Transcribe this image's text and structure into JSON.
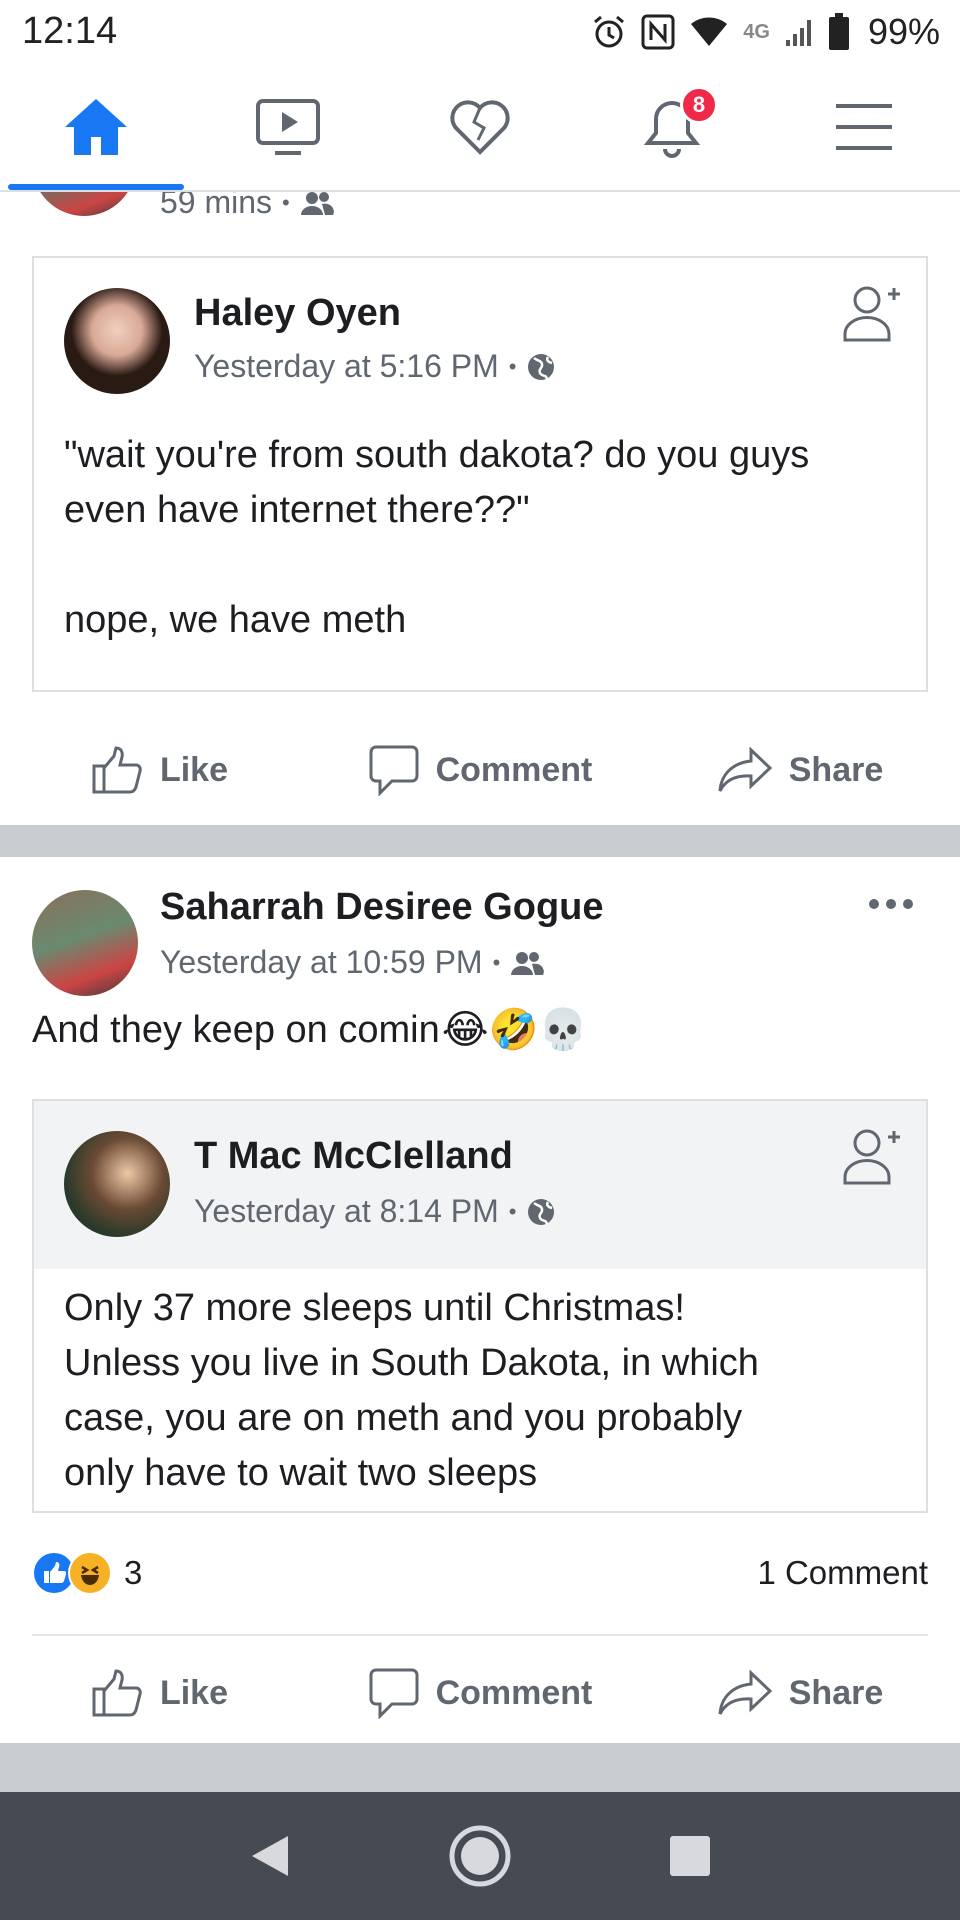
{
  "status_bar": {
    "time": "12:14",
    "network": "4G",
    "battery": "99%",
    "icons": [
      "alarm-icon",
      "nfc-icon",
      "wifi-icon",
      "lte-icon",
      "signal-icon",
      "battery-icon"
    ]
  },
  "nav": {
    "tabs": [
      {
        "name": "home",
        "icon": "home-icon",
        "active": true
      },
      {
        "name": "watch",
        "icon": "video-icon"
      },
      {
        "name": "dating",
        "icon": "heart-icon"
      },
      {
        "name": "notifications",
        "icon": "bell-icon",
        "badge": "8"
      },
      {
        "name": "menu",
        "icon": "menu-icon"
      }
    ],
    "accent_color": "#1877f2",
    "badge_color": "#f02849"
  },
  "posts": [
    {
      "time": "59 mins",
      "audience_icon": "friends-icon",
      "shared": {
        "author": "Haley Oyen",
        "time": "Yesterday at 5:16 PM",
        "audience_icon": "globe-icon",
        "text_line1": "\"wait you're from south dakota? do you guys",
        "text_line2": "even have internet there??\"",
        "text_line3": "nope, we have meth"
      },
      "actions": {
        "like": "Like",
        "comment": "Comment",
        "share": "Share"
      }
    },
    {
      "author": "Saharrah Desiree Gogue",
      "time": "Yesterday at 10:59 PM",
      "audience_icon": "friends-icon",
      "text": "And they keep on comin",
      "emojis": [
        "😂",
        "🤣",
        "💀"
      ],
      "shared": {
        "author": "T Mac McClelland",
        "time": "Yesterday at 8:14 PM",
        "audience_icon": "globe-icon",
        "text_line1": "Only 37 more sleeps until Christmas!",
        "text_line2": "Unless you live in South Dakota, in which",
        "text_line3": "case, you are on meth and you probably",
        "text_line4": "only have to wait two sleeps"
      },
      "reactions": {
        "count": "3",
        "types": [
          "like",
          "haha"
        ]
      },
      "comments": "1 Comment",
      "actions": {
        "like": "Like",
        "comment": "Comment",
        "share": "Share"
      }
    }
  ],
  "android_nav": {
    "icons": [
      "back-icon",
      "home-circle-icon",
      "recents-icon"
    ]
  }
}
